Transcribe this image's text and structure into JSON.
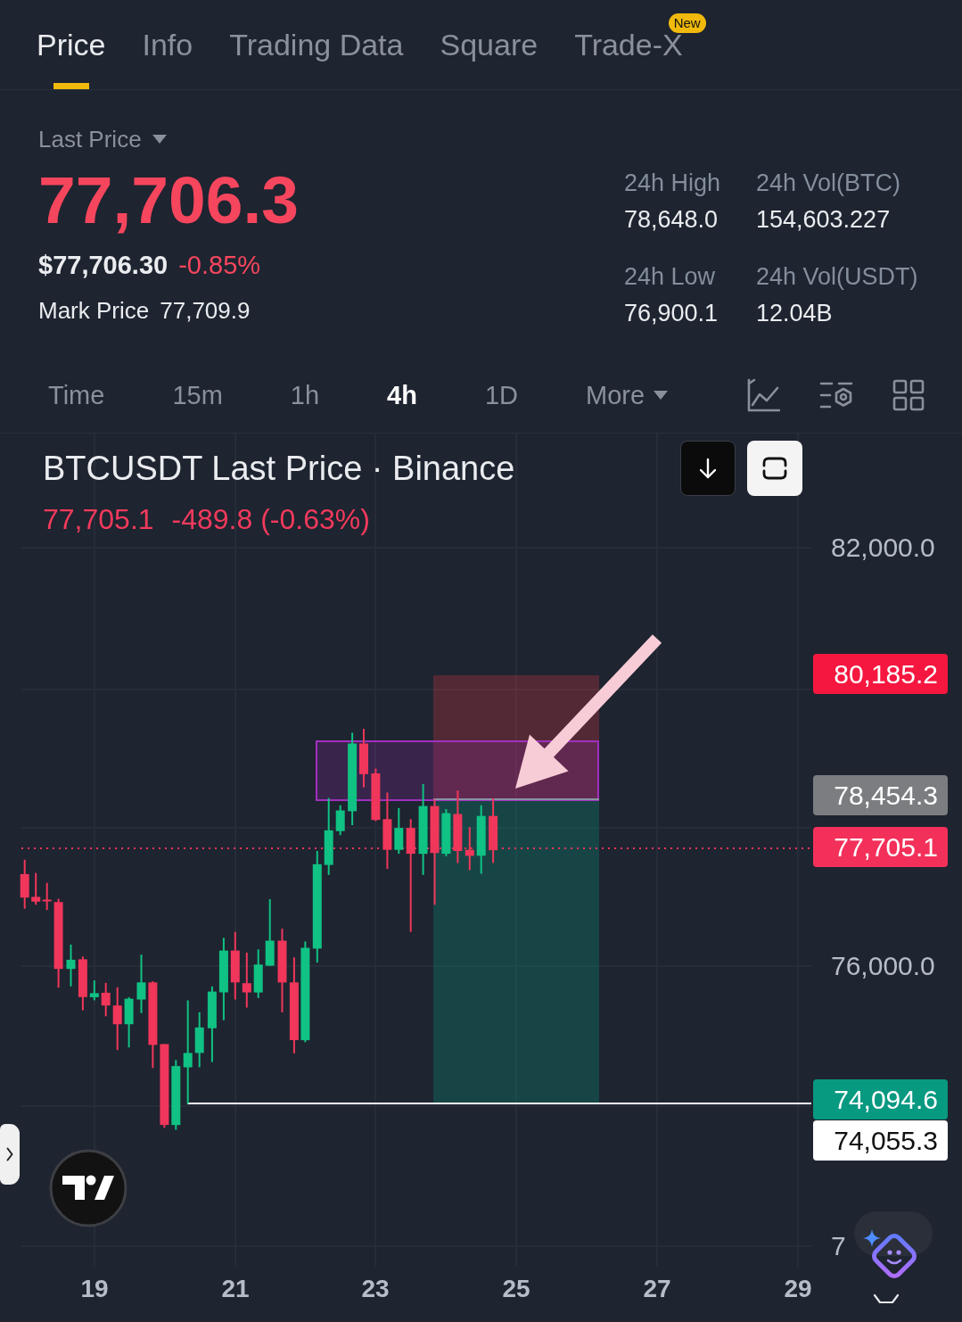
{
  "tabs": [
    {
      "label": "Price",
      "selected": true
    },
    {
      "label": "Info",
      "selected": false
    },
    {
      "label": "Trading Data",
      "selected": false
    },
    {
      "label": "Square",
      "selected": false
    },
    {
      "label": "Trade-X",
      "selected": false,
      "badge": "New"
    }
  ],
  "price_summary": {
    "label": "Last Price",
    "last_price": "77,706.3",
    "usd_price": "$77,706.30",
    "change": "-0.85%",
    "mark_price_label": "Mark Price",
    "mark_price": "77,709.9"
  },
  "stats": [
    {
      "label": "24h High",
      "value": "78,648.0"
    },
    {
      "label": "24h Vol(BTC)",
      "value": "154,603.227"
    },
    {
      "label": "24h Low",
      "value": "76,900.1"
    },
    {
      "label": "24h Vol(USDT)",
      "value": "12.04B"
    }
  ],
  "intervals": [
    {
      "label": "Time",
      "kind": "interval",
      "selected": false
    },
    {
      "label": "15m",
      "kind": "interval",
      "selected": false
    },
    {
      "label": "1h",
      "kind": "interval",
      "selected": false
    },
    {
      "label": "4h",
      "kind": "interval",
      "selected": true
    },
    {
      "label": "1D",
      "kind": "interval",
      "selected": false
    },
    {
      "label": "More",
      "kind": "dropdown",
      "selected": false
    }
  ],
  "chart": {
    "title": "BTCUSDT Last Price · Binance",
    "last_price": "77,705.1",
    "change": "-489.8 (-0.63%)",
    "price_axis": [
      "82,000.0",
      "76,000.0",
      "7"
    ],
    "price_tags": [
      {
        "label": "80,185.2",
        "color": "#f5173f"
      },
      {
        "label": "78,454.3",
        "color": "#7b7d80"
      },
      {
        "label": "77,705.1",
        "color": "#f3305a"
      },
      {
        "label": "74,094.6",
        "color": "#089981"
      },
      {
        "label": "74,055.3",
        "color": "#ffffff"
      }
    ],
    "date_axis": [
      "19",
      "21",
      "23",
      "25",
      "27",
      "29"
    ]
  }
}
